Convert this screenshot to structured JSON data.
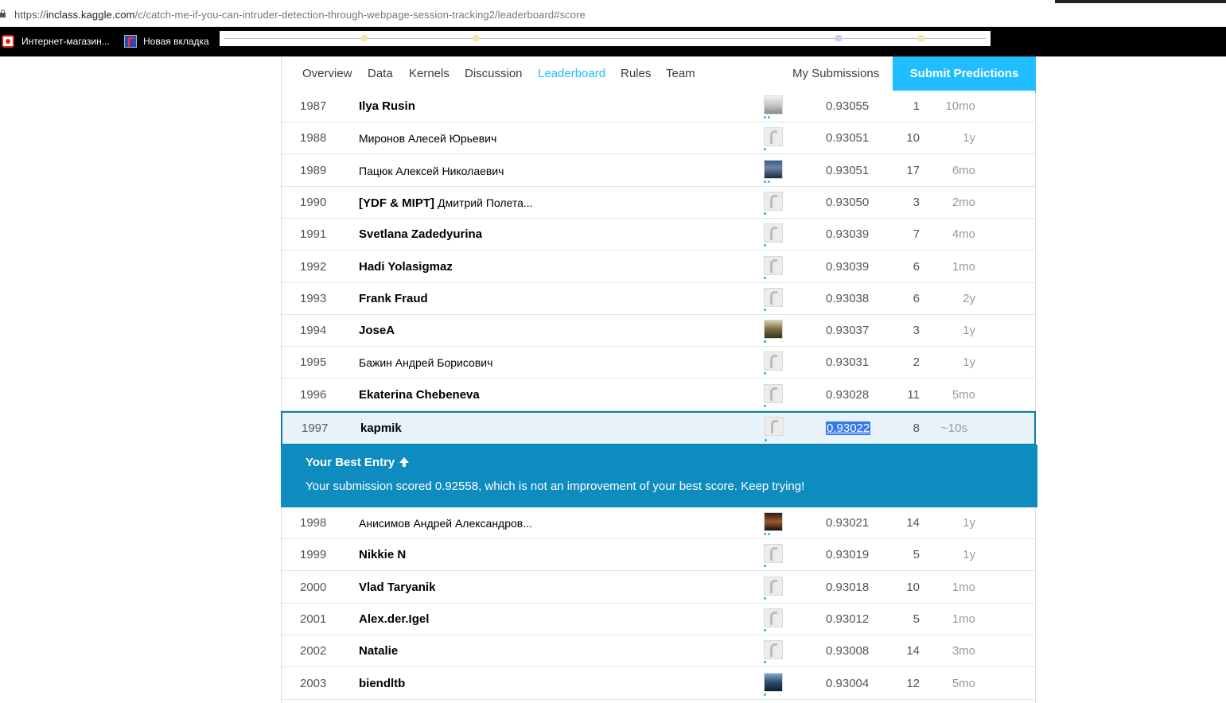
{
  "browser": {
    "url_prefix": "https://",
    "url_domain": "inclass.kaggle.com",
    "url_path": "/c/catch-me-if-you-can-intruder-detection-through-webpage-session-tracking2/leaderboard#score",
    "bookmarks": [
      {
        "label": "Интернет-магазин...",
        "icon": "shop-favicon-icon"
      },
      {
        "label": "Новая вкладка",
        "icon": "new-tab-favicon-icon"
      }
    ]
  },
  "nav": {
    "tabs": [
      "Overview",
      "Data",
      "Kernels",
      "Discussion",
      "Leaderboard",
      "Rules",
      "Team"
    ],
    "active_tab": "Leaderboard",
    "my_submissions": "My Submissions",
    "submit": "Submit Predictions",
    "accent_color": "#20beff"
  },
  "rows_before": [
    {
      "rank": "1987",
      "name": "Ilya Rusin",
      "score": "0.93055",
      "entries": "1",
      "last": "10mo",
      "avatar": "photo0",
      "tier": "blue2"
    },
    {
      "rank": "1988",
      "name": "Миронов Алесей Юрьевич",
      "score": "0.93051",
      "entries": "10",
      "last": "1y",
      "avatar": "default",
      "tier": "green1",
      "cyr": true
    },
    {
      "rank": "1989",
      "name": "Пацюк Алексей Николаевич",
      "score": "0.93051",
      "entries": "17",
      "last": "6mo",
      "avatar": "photo",
      "tier": "blue2",
      "cyr": true
    },
    {
      "rank": "1990",
      "tag": "[YDF & MIPT]",
      "name": "Дмитрий Полета...",
      "score": "0.93050",
      "entries": "3",
      "last": "2mo",
      "avatar": "default",
      "tier": "green1"
    },
    {
      "rank": "1991",
      "name": "Svetlana Zadedyurina",
      "score": "0.93039",
      "entries": "7",
      "last": "4mo",
      "avatar": "default",
      "tier": "green1"
    },
    {
      "rank": "1992",
      "name": "Hadi Yolasigmaz",
      "score": "0.93039",
      "entries": "6",
      "last": "1mo",
      "avatar": "default",
      "tier": "green1"
    },
    {
      "rank": "1993",
      "name": "Frank Fraud",
      "score": "0.93038",
      "entries": "6",
      "last": "2y",
      "avatar": "default",
      "tier": "green1"
    },
    {
      "rank": "1994",
      "name": "JoseA",
      "score": "0.93037",
      "entries": "3",
      "last": "1y",
      "avatar": "photo2",
      "tier": "green1"
    },
    {
      "rank": "1995",
      "name": "Бажин Андрей Борисович",
      "score": "0.93031",
      "entries": "2",
      "last": "1y",
      "avatar": "default",
      "tier": "green1",
      "cyr": true
    },
    {
      "rank": "1996",
      "name": "Ekaterina Chebeneva",
      "score": "0.93028",
      "entries": "11",
      "last": "5mo",
      "avatar": "default",
      "tier": "green1"
    }
  ],
  "my_row": {
    "rank": "1997",
    "name": "kapmik",
    "score": "0.93022",
    "entries": "8",
    "last": "~10s"
  },
  "best_entry": {
    "title": "Your Best Entry",
    "message": "Your submission scored 0.92558, which is not an improvement of your best score. Keep trying!",
    "color": "#0e8cbf"
  },
  "rows_after": [
    {
      "rank": "1998",
      "name": "Анисимов Андрей Александров...",
      "score": "0.93021",
      "entries": "14",
      "last": "1y",
      "avatar": "photo3",
      "tier": "blue2",
      "cyr": true
    },
    {
      "rank": "1999",
      "name": "Nikkie N",
      "score": "0.93019",
      "entries": "5",
      "last": "1y",
      "avatar": "default",
      "tier": "green1"
    },
    {
      "rank": "2000",
      "name": "Vlad Taryanik",
      "score": "0.93018",
      "entries": "10",
      "last": "1mo",
      "avatar": "default",
      "tier": "green1"
    },
    {
      "rank": "2001",
      "name": "Alex.der.Igel",
      "score": "0.93012",
      "entries": "5",
      "last": "1mo",
      "avatar": "default",
      "tier": "green1"
    },
    {
      "rank": "2002",
      "name": "Natalie",
      "score": "0.93008",
      "entries": "14",
      "last": "3mo",
      "avatar": "default",
      "tier": "green1"
    },
    {
      "rank": "2003",
      "name": "biendltb",
      "score": "0.93004",
      "entries": "12",
      "last": "5mo",
      "avatar": "photo4",
      "tier": "green1"
    }
  ]
}
